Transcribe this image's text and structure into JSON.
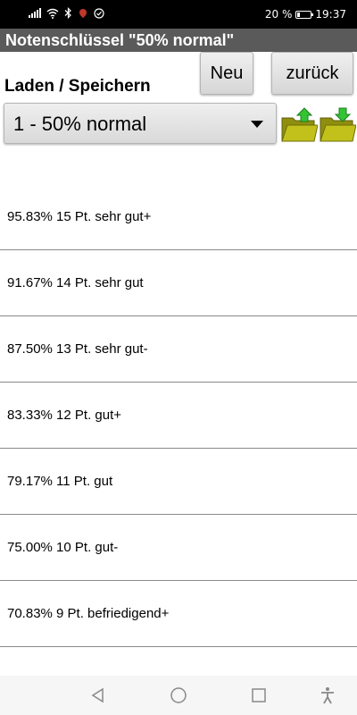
{
  "status_bar": {
    "battery": "20 %",
    "time": "19:37"
  },
  "app": {
    "title": "Notenschlüssel \"50% normal\""
  },
  "toolbar": {
    "new_label": "Neu",
    "back_label": "zurück"
  },
  "section": {
    "label": "Laden / Speichern"
  },
  "dropdown": {
    "selected": "1 - 50% normal"
  },
  "grades": [
    {
      "text": "95.83% 15 Pt. sehr gut+"
    },
    {
      "text": "91.67% 14 Pt. sehr gut"
    },
    {
      "text": "87.50% 13 Pt. sehr gut-"
    },
    {
      "text": "83.33% 12 Pt. gut+"
    },
    {
      "text": "79.17% 11 Pt. gut"
    },
    {
      "text": "75.00% 10 Pt. gut-"
    },
    {
      "text": "70.83% 9 Pt. befriedigend+"
    }
  ],
  "icons": {
    "load": "folder-load-icon",
    "save": "folder-save-icon",
    "back_nav": "triangle-back-icon",
    "home_nav": "circle-home-icon",
    "recents_nav": "square-recents-icon",
    "accessibility": "accessibility-icon"
  },
  "colors": {
    "title_bar": "#5a5a5a",
    "folder": "#b5b418",
    "arrow": "#2fbf2f"
  }
}
